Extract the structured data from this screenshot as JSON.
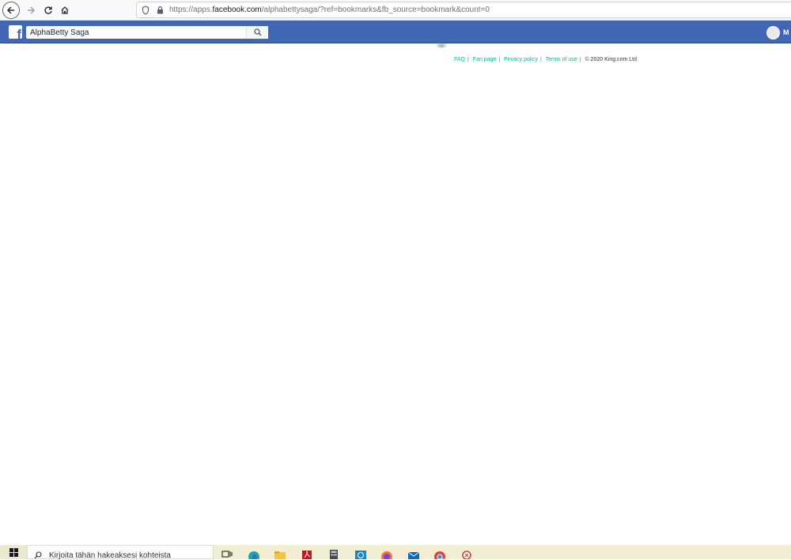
{
  "browser": {
    "url_prefix": "https://apps.",
    "url_domain": "facebook.com",
    "url_suffix": "/alphabettysaga/?ref=bookmarks&fb_source=bookmark&count=0"
  },
  "fb_header": {
    "logo_letter": "f",
    "search_value": "AlphaBetty Saga",
    "username": "M",
    "color": "#4267b2"
  },
  "game_footer": {
    "links": [
      "FAQ",
      "Fan page",
      "Privacy policy",
      "Terms of use"
    ],
    "separator": "|",
    "copyright": "© 2020 King.com Ltd",
    "link_color": "#0bb19a"
  },
  "taskbar": {
    "search_placeholder": "Kirjoita tähän hakeaksesi kohteista",
    "icons": [
      "task-view-icon",
      "edge-icon",
      "file-explorer-icon",
      "acrobat-icon",
      "calculator-icon",
      "network-icon",
      "firefox-icon",
      "mail-icon",
      "chrome-icon",
      "snipping-tool-icon"
    ]
  }
}
